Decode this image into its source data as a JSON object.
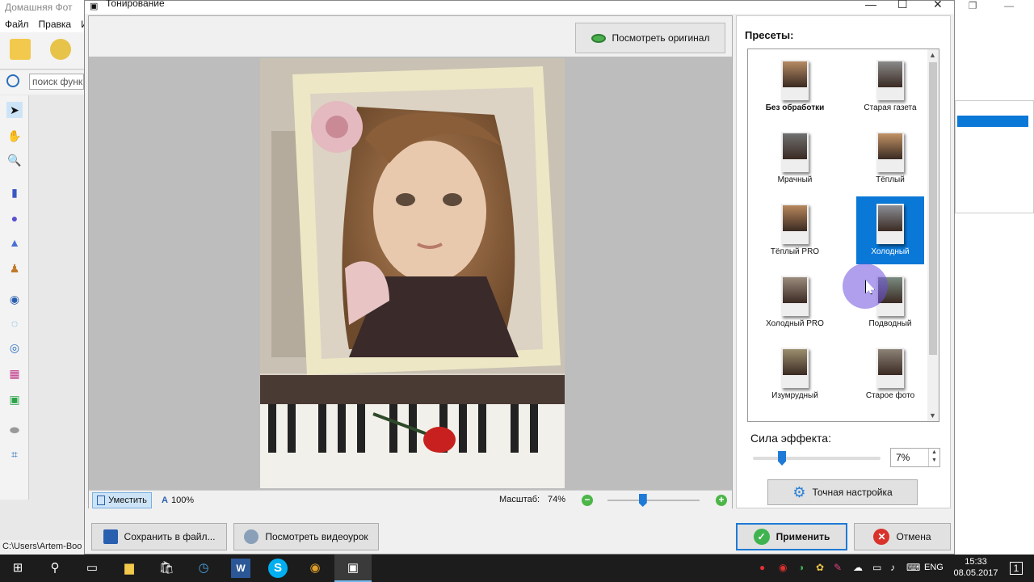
{
  "background_app": {
    "title": "Домашняя Фот",
    "menu": [
      "Файл",
      "Правка",
      "И"
    ],
    "search_placeholder": "поиск функ",
    "status_path": "C:\\Users\\Artem-Boo"
  },
  "dialog": {
    "title": "Тонирование",
    "view_original_button": "Посмотреть оригинал",
    "fit_button": "Уместить",
    "zoom_100": "100%",
    "zoom_label": "Масштаб:",
    "zoom_value": "74%",
    "zoom_fraction": 0.34
  },
  "presets": {
    "title": "Пресеты:",
    "items": [
      {
        "label": "Без обработки",
        "bold": true,
        "tone": "#b58a63"
      },
      {
        "label": "Старая газета",
        "tone": "#8a8a8a"
      },
      {
        "label": "Мрачный",
        "tone": "#707070"
      },
      {
        "label": "Тёплый",
        "tone": "#c19265"
      },
      {
        "label": "Тёплый PRO",
        "tone": "#b8875c"
      },
      {
        "label": "Холодный",
        "tone": "#8b8f96",
        "selected": true
      },
      {
        "label": "Холодный PRO",
        "tone": "#9a8b7d"
      },
      {
        "label": "Подводный",
        "tone": "#7a8a80"
      },
      {
        "label": "Изумрудный",
        "tone": "#9a8e6e"
      },
      {
        "label": "Старое фото",
        "tone": "#8c8276"
      }
    ]
  },
  "effect": {
    "label": "Сила эффекта:",
    "value": "7%",
    "fraction": 0.07,
    "fine_tune_button": "Точная настройка"
  },
  "buttons": {
    "save": "Сохранить в файл...",
    "video": "Посмотреть видеоурок",
    "apply": "Применить",
    "cancel": "Отмена"
  },
  "taskbar": {
    "language": "ENG",
    "time": "15:33",
    "date": "08.05.2017",
    "notifications": "1"
  }
}
